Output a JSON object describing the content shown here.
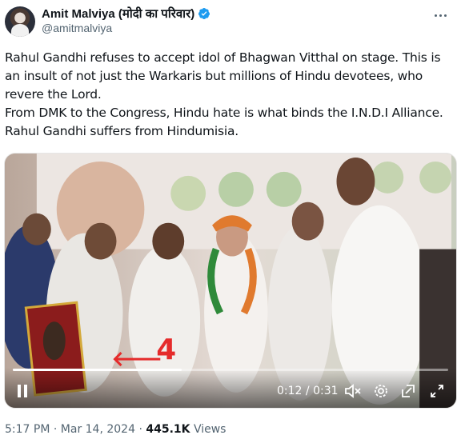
{
  "author": {
    "display_name": "Amit Malviya (मोदी का परिवार)",
    "handle": "@amitmalviya",
    "verified_badge_icon": "verified-badge-icon",
    "verified_color": "#1d9bf0"
  },
  "more_icon": "more-options-icon",
  "tweet": {
    "text": "Rahul Gandhi refuses to accept idol of Bhagwan Vitthal on stage. This is an insult of not just the Warkaris but millions of Hindu devotees, who revere the Lord.\nFrom DMK to the Congress, Hindu hate is what binds the I.N.D.I Alliance. Rahul Gandhi suffers from Hindumisia."
  },
  "video": {
    "overlay_number": "4",
    "current_time": "0:12",
    "duration": "0:31",
    "time_separator": " / ",
    "progress": 0.387,
    "icons": [
      "pause-icon",
      "mute-icon",
      "settings-gear-icon",
      "pip-icon",
      "fullscreen-icon"
    ]
  },
  "meta": {
    "time": "5:17 PM",
    "sep1": " · ",
    "date": "Mar 14, 2024",
    "sep2": " · ",
    "views_count": "445.1K",
    "views_label": " Views"
  }
}
